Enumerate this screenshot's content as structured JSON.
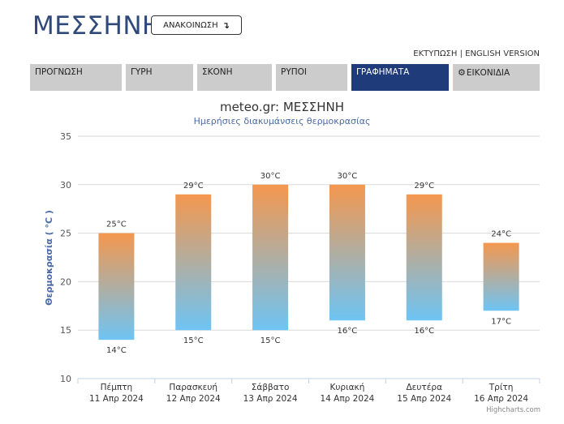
{
  "header": {
    "title": "ΜΕΣΣΗΝΗ",
    "announce_label": "ΑΝΑΚΟΙΝΩΣΗ",
    "print_label": "ΕΚΤΥΠΩΣΗ",
    "separator": "|",
    "english_label": "ENGLISH VERSION"
  },
  "tabs": [
    {
      "label": "ΠΡΟΓΝΩΣΗ"
    },
    {
      "label": "ΓΥΡΗ"
    },
    {
      "label": "ΣΚΟΝΗ"
    },
    {
      "label": "ΡΥΠΟΙ"
    },
    {
      "label": "ΓΡΑΦΗΜΑΤΑ",
      "active": true
    },
    {
      "label": "ΕΙΚΟΝΙΔΙΑ",
      "icon": "gear-icon"
    }
  ],
  "colors": {
    "brand": "#2f4a7a",
    "active_tab": "#1f3b7a",
    "tab_bg": "#cccccc",
    "bar_top": "#f4974e",
    "bar_bottom": "#6ec4f4"
  },
  "chart_data": {
    "type": "bar",
    "subtype": "columnrange",
    "title": "meteo.gr: ΜΕΣΣΗΝΗ",
    "subtitle": "Ημερήσιες διακυμάνσεις θερμοκρασίας",
    "ylabel": "Θερμοκρασία ( °C )",
    "xlabel": "",
    "ylim": [
      10,
      35
    ],
    "yticks": [
      10,
      15,
      20,
      25,
      30,
      35
    ],
    "grid": true,
    "unit": "°C",
    "categories": [
      {
        "day": "Πέμπτη",
        "date": "11 Απρ 2024"
      },
      {
        "day": "Παρασκευή",
        "date": "12 Απρ 2024"
      },
      {
        "day": "Σάββατο",
        "date": "13 Απρ 2024"
      },
      {
        "day": "Κυριακή",
        "date": "14 Απρ 2024"
      },
      {
        "day": "Δευτέρα",
        "date": "15 Απρ 2024"
      },
      {
        "day": "Τρίτη",
        "date": "16 Απρ 2024"
      }
    ],
    "low": [
      14,
      15,
      15,
      16,
      16,
      17
    ],
    "high": [
      25,
      29,
      30,
      30,
      29,
      24
    ],
    "credit": "Highcharts.com"
  }
}
